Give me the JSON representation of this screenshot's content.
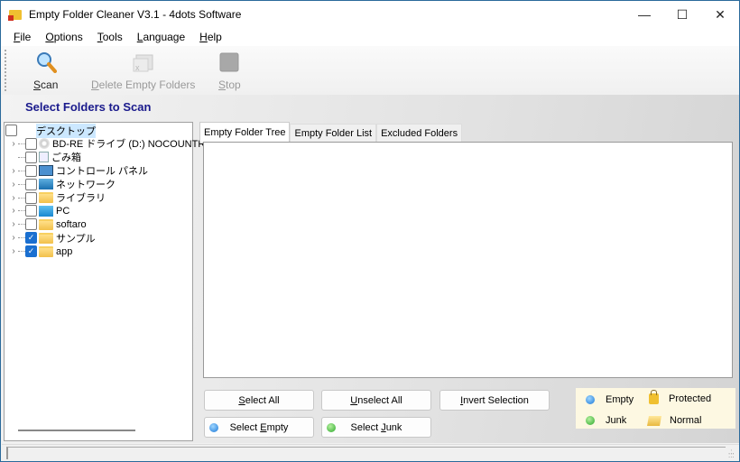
{
  "window": {
    "title": "Empty Folder Cleaner V3.1 - 4dots Software",
    "controls": {
      "minimize": "—",
      "maximize": "☐",
      "close": "✕"
    }
  },
  "menu": [
    {
      "label": "File",
      "accel": "F",
      "rest": "ile"
    },
    {
      "label": "Options",
      "accel": "O",
      "rest": "ptions"
    },
    {
      "label": "Tools",
      "accel": "T",
      "rest": "ools"
    },
    {
      "label": "Language",
      "accel": "L",
      "rest": "anguage"
    },
    {
      "label": "Help",
      "accel": "H",
      "rest": "elp"
    }
  ],
  "toolbar": {
    "scan": {
      "accel": "S",
      "rest": "can",
      "icon": "magnifier-icon",
      "enabled": true
    },
    "delete": {
      "accel": "D",
      "rest": "elete Empty Folders",
      "icon": "delete-folder-icon",
      "enabled": false
    },
    "stop": {
      "accel": "S",
      "rest": "top",
      "icon": "stop-icon",
      "enabled": false
    }
  },
  "section_title": "Select Folders to Scan",
  "tree": [
    {
      "label": "デスクトップ",
      "icon": "desktop",
      "checked": false,
      "expander": false,
      "level": 0,
      "selected": true
    },
    {
      "label": "BD-RE ドライブ (D:) NOCOUNTRY",
      "icon": "disc",
      "checked": false,
      "expander": true,
      "level": 1
    },
    {
      "label": "ごみ箱",
      "icon": "bin",
      "checked": false,
      "expander": false,
      "level": 1
    },
    {
      "label": "コントロール パネル",
      "icon": "ctrl",
      "checked": false,
      "expander": true,
      "level": 1
    },
    {
      "label": "ネットワーク",
      "icon": "net",
      "checked": false,
      "expander": true,
      "level": 1
    },
    {
      "label": "ライブラリ",
      "icon": "folder",
      "checked": false,
      "expander": true,
      "level": 1
    },
    {
      "label": "PC",
      "icon": "monitor",
      "checked": false,
      "expander": true,
      "level": 1
    },
    {
      "label": "softaro",
      "icon": "folder",
      "checked": false,
      "expander": true,
      "level": 1
    },
    {
      "label": "サンプル",
      "icon": "folder",
      "checked": true,
      "expander": true,
      "level": 1
    },
    {
      "label": "app",
      "icon": "folder",
      "checked": true,
      "expander": true,
      "level": 1
    }
  ],
  "tabs": [
    "Empty Folder Tree",
    "Empty Folder List",
    "Excluded Folders"
  ],
  "buttons": {
    "select_all": {
      "accel": "S",
      "rest": "elect All"
    },
    "unselect_all": {
      "accel": "U",
      "rest": "nselect All"
    },
    "invert_selection": {
      "accel": "I",
      "rest": "nvert Selection"
    },
    "select_empty": {
      "pre": "Select ",
      "accel": "E",
      "rest": "mpty"
    },
    "select_junk": {
      "pre": "Select ",
      "accel": "J",
      "rest": "unk"
    }
  },
  "legend": {
    "empty": "Empty",
    "junk": "Junk",
    "protected": "Protected",
    "normal": "Normal"
  }
}
